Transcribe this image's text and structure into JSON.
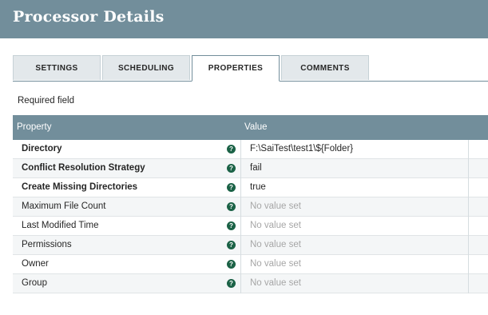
{
  "header": {
    "title": "Processor Details"
  },
  "tabs": [
    {
      "label": "SETTINGS",
      "active": false
    },
    {
      "label": "SCHEDULING",
      "active": false
    },
    {
      "label": "PROPERTIES",
      "active": true
    },
    {
      "label": "COMMENTS",
      "active": false
    }
  ],
  "required_text": "Required field",
  "grid": {
    "columns": {
      "property": "Property",
      "value": "Value"
    },
    "rows": [
      {
        "name": "Directory",
        "required": true,
        "value": "F:\\SaiTest\\test1\\${Folder}",
        "is_set": true
      },
      {
        "name": "Conflict Resolution Strategy",
        "required": true,
        "value": "fail",
        "is_set": true
      },
      {
        "name": "Create Missing Directories",
        "required": true,
        "value": "true",
        "is_set": true
      },
      {
        "name": "Maximum File Count",
        "required": false,
        "value": "No value set",
        "is_set": false
      },
      {
        "name": "Last Modified Time",
        "required": false,
        "value": "No value set",
        "is_set": false
      },
      {
        "name": "Permissions",
        "required": false,
        "value": "No value set",
        "is_set": false
      },
      {
        "name": "Owner",
        "required": false,
        "value": "No value set",
        "is_set": false
      },
      {
        "name": "Group",
        "required": false,
        "value": "No value set",
        "is_set": false
      }
    ]
  },
  "colors": {
    "header": "#728e9b",
    "help_icon": "#1b6246",
    "unset_value": "#a6a6a6"
  },
  "icons": {
    "help": "question-circle-icon"
  }
}
